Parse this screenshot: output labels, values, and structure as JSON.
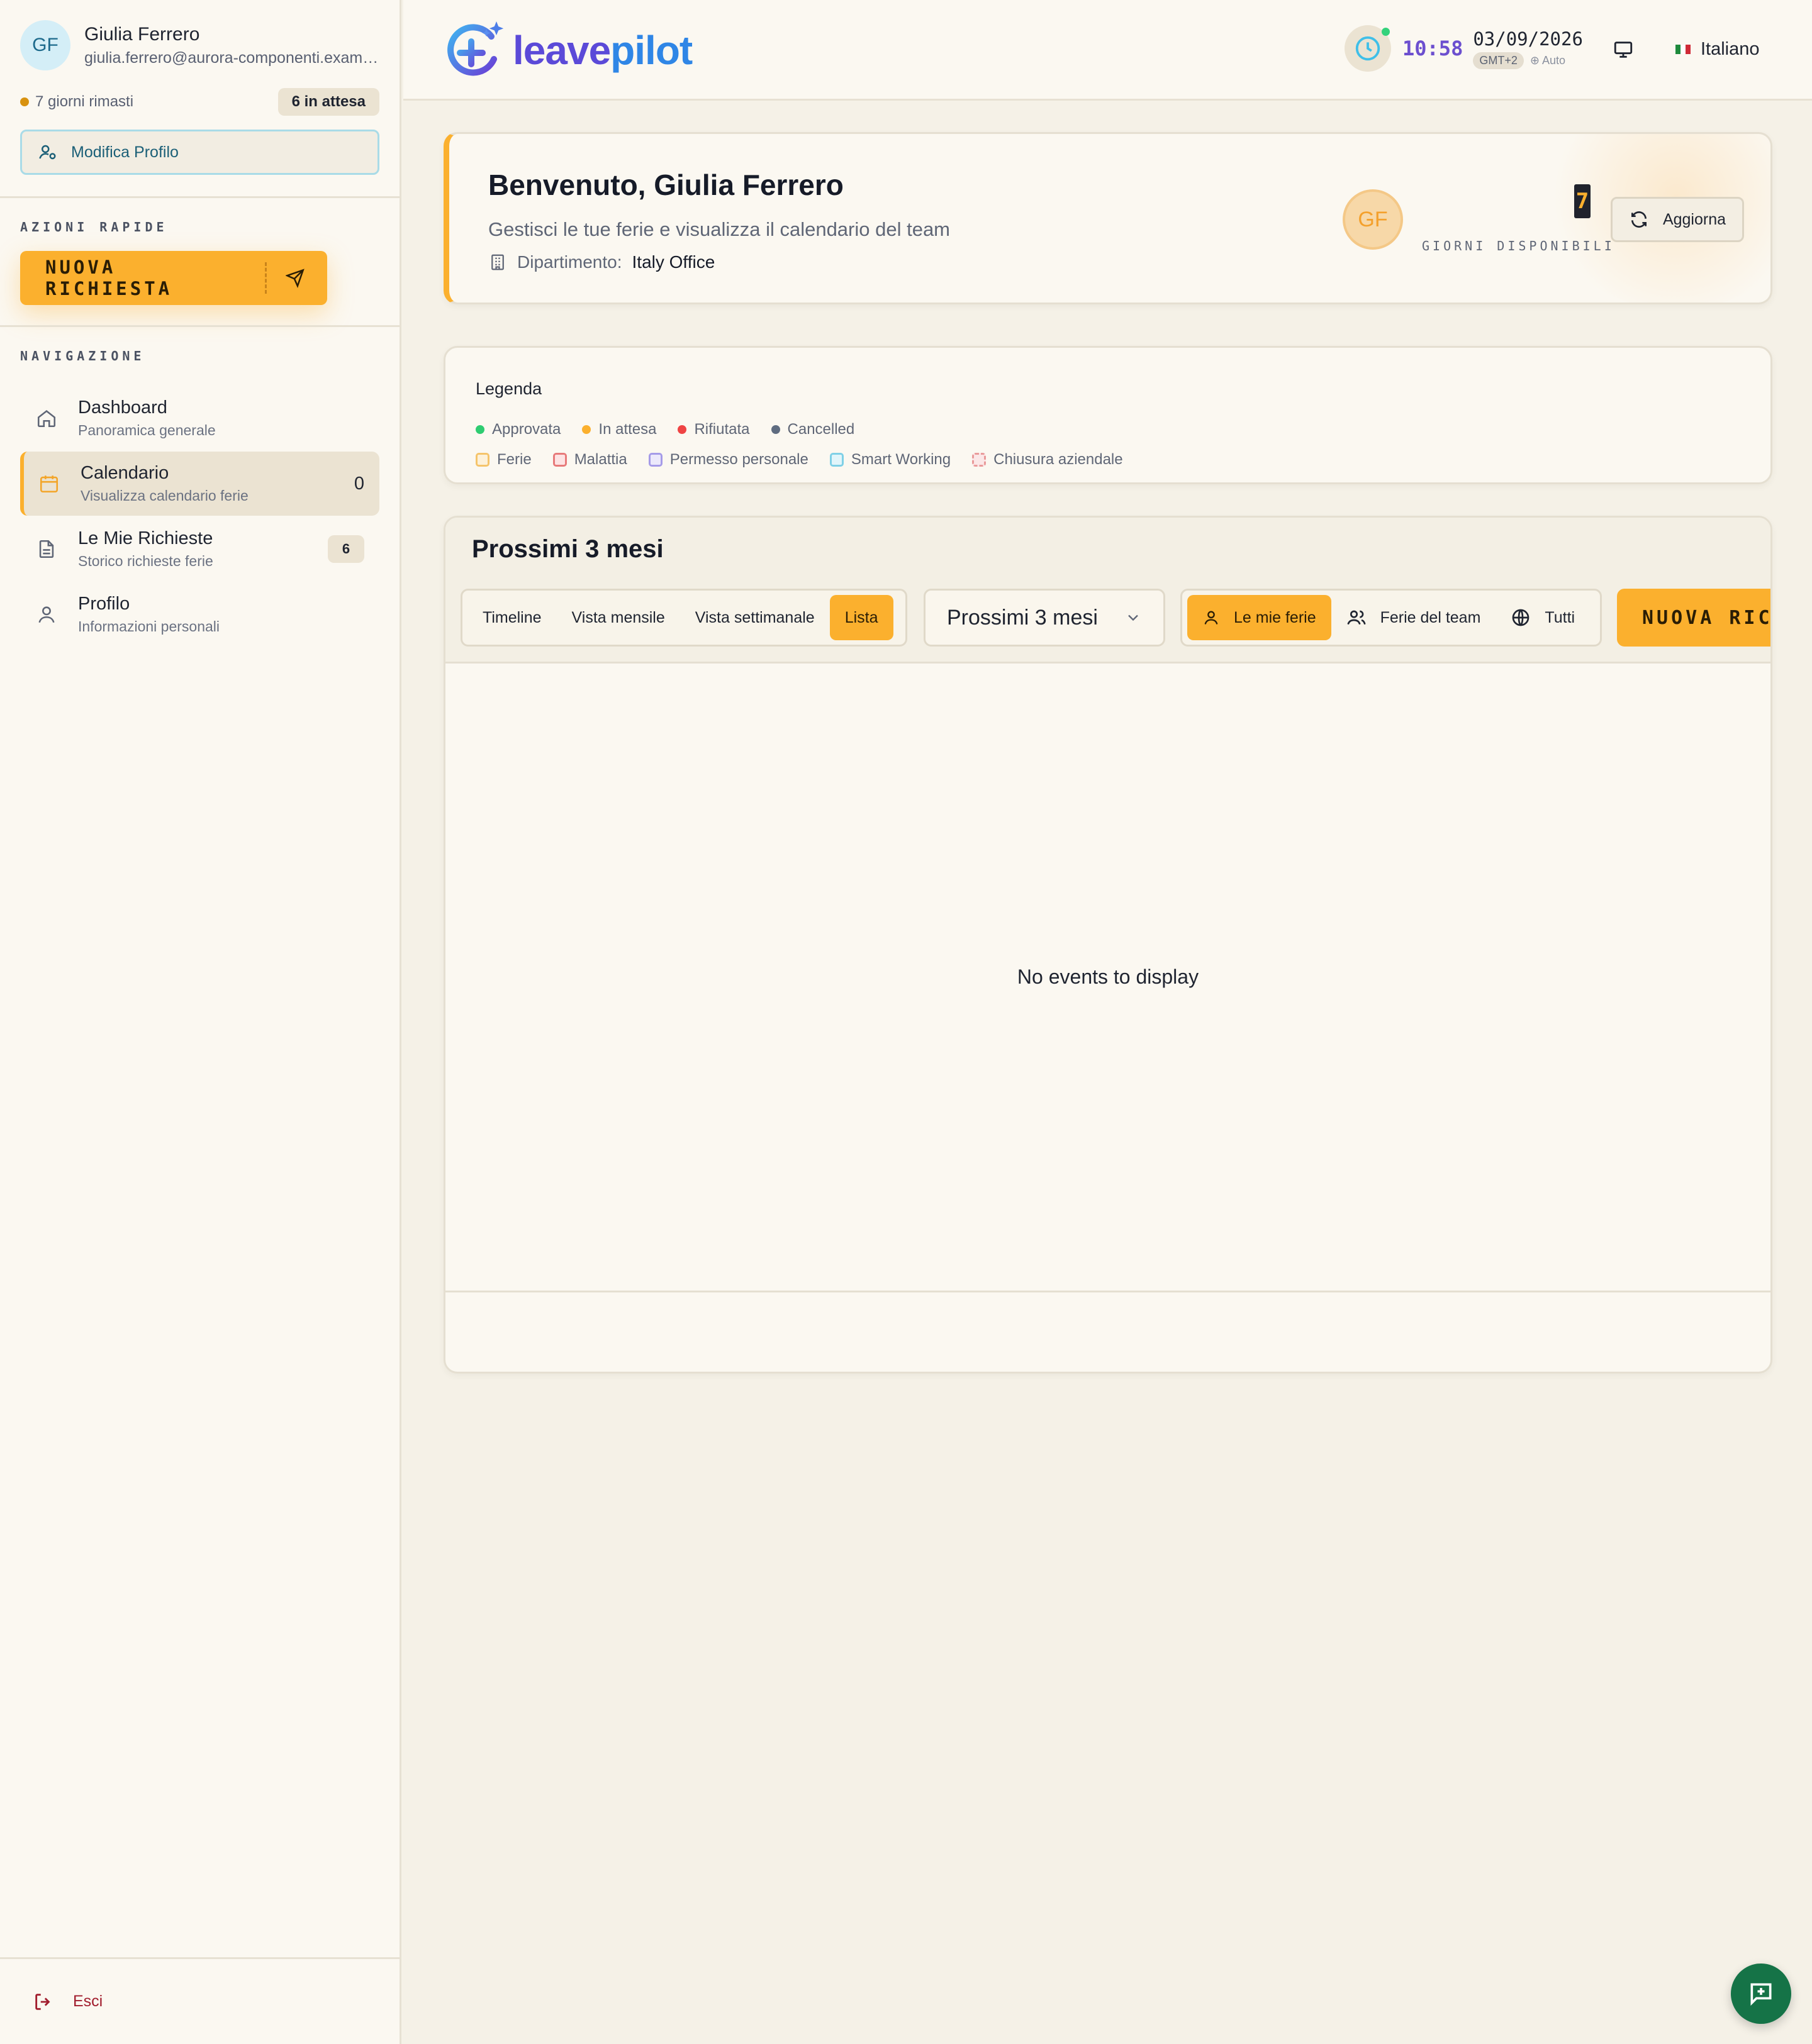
{
  "user": {
    "initials": "GF",
    "name": "Giulia Ferrero",
    "email": "giulia.ferrero@aurora-componenti.examp...",
    "days_left": "7 giorni rimasti",
    "pending": "6 in attesa",
    "edit_profile": "Modifica Profilo"
  },
  "sidebar": {
    "quick_actions_label": "AZIONI RAPIDE",
    "new_request": "NUOVA RICHIESTA",
    "nav_label": "NAVIGAZIONE",
    "items": [
      {
        "title": "Dashboard",
        "subtitle": "Panoramica generale",
        "icon": "home-icon"
      },
      {
        "title": "Calendario",
        "subtitle": "Visualizza calendario ferie",
        "count": "0",
        "icon": "calendar-icon",
        "active": true
      },
      {
        "title": "Le Mie Richieste",
        "subtitle": "Storico richieste ferie",
        "badge": "6",
        "icon": "document-icon"
      },
      {
        "title": "Profilo",
        "subtitle": "Informazioni personali",
        "icon": "user-icon"
      }
    ],
    "logout": "Esci"
  },
  "topbar": {
    "logo_part1": "leave",
    "logo_part2": "pilot",
    "time": "10:58",
    "date": "03/09/2026",
    "timezone": "GMT+2",
    "tz_mode": "Auto",
    "language": "Italiano"
  },
  "welcome": {
    "title": "Benvenuto, Giulia Ferrero",
    "subtitle": "Gestisci le tue ferie e visualizza il calendario del team",
    "dept_label": "Dipartimento:",
    "dept_value": "Italy Office",
    "avatar": "GF",
    "days_available": "7",
    "days_label": "GIORNI DISPONIBILI",
    "refresh": "Aggiorna"
  },
  "legend": {
    "title": "Legenda",
    "statuses": [
      {
        "label": "Approvata",
        "color": "#2ecc71"
      },
      {
        "label": "In attesa",
        "color": "#fbb02e"
      },
      {
        "label": "Rifiutata",
        "color": "#ef4444"
      },
      {
        "label": "Cancelled",
        "color": "#5f6c80"
      }
    ],
    "types": [
      {
        "label": "Ferie",
        "color": "#f5c46b",
        "fill": "#fdf1d9"
      },
      {
        "label": "Malattia",
        "color": "#e77a7a",
        "fill": "#fde3e3"
      },
      {
        "label": "Permesso personale",
        "color": "#a59be8",
        "fill": "#ece9fb"
      },
      {
        "label": "Smart Working",
        "color": "#7fd0e6",
        "fill": "#e1f5fa"
      },
      {
        "label": "Chiusura aziendale",
        "color": "#e99a9a",
        "fill": "#fbe7e7"
      }
    ]
  },
  "calendar": {
    "title": "Prossimi 3 mesi",
    "views": [
      "Timeline",
      "Vista mensile",
      "Vista settimanale",
      "Lista"
    ],
    "active_view": "Lista",
    "range": "Prossimi 3 mesi",
    "filters": [
      "Le mie ferie",
      "Ferie del team",
      "Tutti"
    ],
    "active_filter": "Le mie ferie",
    "new_request": "NUOVA RICHIESTA",
    "empty": "No events to display"
  },
  "colors": {
    "accent": "#fbb02e",
    "brand_purple": "#5b4ad8",
    "brand_blue": "#2f86e6",
    "logout": "#a11d2e",
    "fab": "#157347"
  }
}
